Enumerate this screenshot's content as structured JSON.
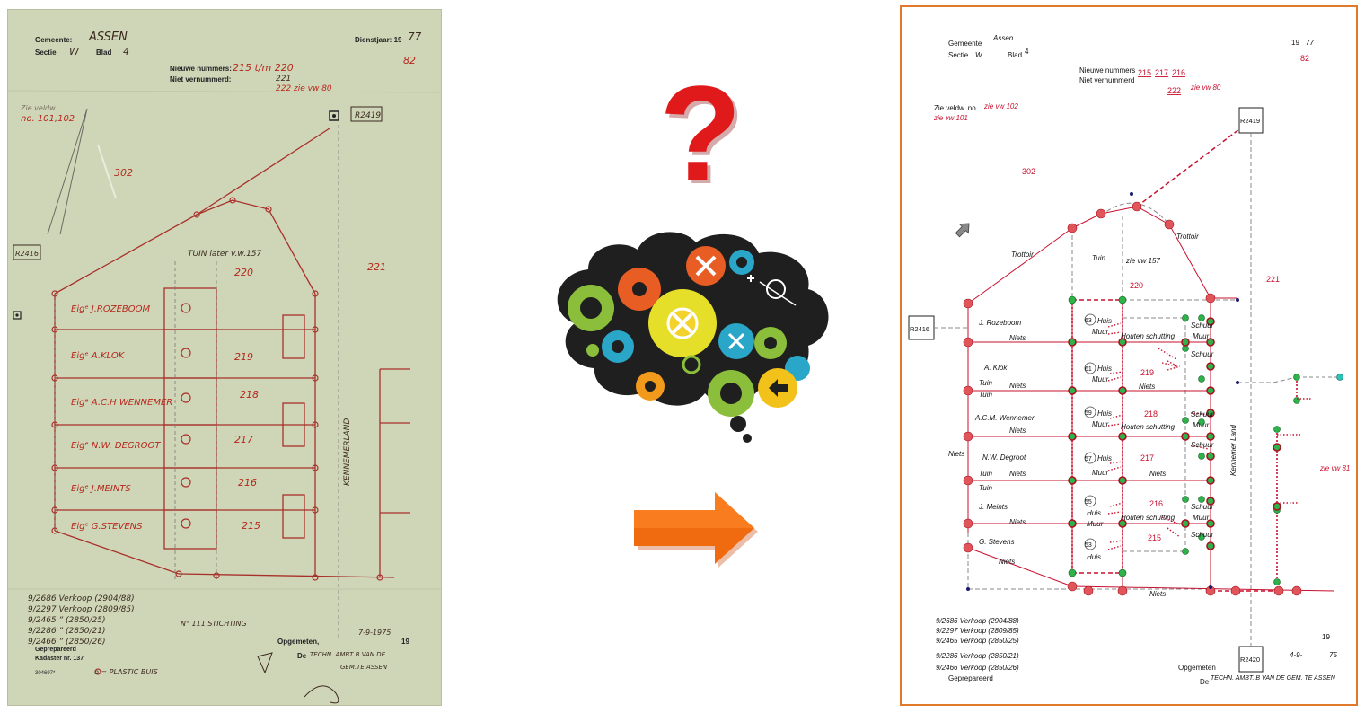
{
  "left_scan": {
    "gemeente_label": "Gemeente:",
    "gemeente_value": "ASSEN",
    "sectie_label": "Sectie",
    "sectie_value": "W",
    "blad_label": "Blad",
    "blad_value": "4",
    "dienstjaar_label": "Dienstjaar: 19",
    "dienstjaar_value": "77",
    "dienstjaar_extra": "82",
    "nieuwe_label": "Nieuwe nummers:",
    "nieuwe_value": "215 t/m 220",
    "niet_label": "Niet vernummerd:",
    "niet_value1": "221",
    "niet_value2": "222 zie vw 80",
    "zie_veldw": "Zie veldw.",
    "zie_no": "no. 101,102",
    "r2419": "R2419",
    "r2416": "R2416",
    "p302": "302",
    "p220": "220",
    "p221": "221",
    "p219": "219",
    "p218": "218",
    "p217": "217",
    "p216": "216",
    "p215": "215",
    "tuin_later": "TUIN later v.w.157",
    "owners": [
      "Eigᵉ J.ROZEBOOM",
      "Eigᵉ A.KLOK",
      "Eigᵉ A.C.H WENNEMER",
      "Eigᵉ N.W. DEGROOT",
      "Eigᵉ J.MEINTS",
      "Eigᵉ G.STEVENS"
    ],
    "kennemerland": "KENNEMERLAND",
    "verkoop": [
      "9/2686 Verkoop (2904/88)",
      "9/2297 Verkoop (2809/85)",
      "9/2465      ”      (2850/25)",
      "9/2286      ”      (2850/21)",
      "9/2466      ”      (2850/26)"
    ],
    "stichting": "N° 111 STICHTING",
    "plastic": "o = PLASTIC BUIS",
    "gepr": "Geprepareerd",
    "kadaster": "Kadaster nr. 137",
    "opgemeten": "Opgemeten,",
    "opgemeten_val": "7-9-1975",
    "de_label": "De",
    "de_val": "TECHN. AMBT B VAN DE",
    "de_val2": "GEM.TE ASSEN",
    "bottom_code": "304697*",
    "dienst_19": "19"
  },
  "middle": {
    "question_mark": "?",
    "arrow_name": "arrow-right"
  },
  "right_map": {
    "gemeente_label": "Gemeente",
    "gemeente_value": "Assen",
    "sectie_label": "Sectie",
    "sectie_value": "W",
    "blad_label": "Blad",
    "blad_value": "4",
    "year_19": "19",
    "year_77": "77",
    "year_82": "82",
    "nieuwe_label": "Nieuwe nummers",
    "niet_label": "Niet vernummerd",
    "nieuwe_215": "215",
    "nieuwe_217": "217",
    "nieuwe_216": "216",
    "niet_222": "222",
    "zie_vw80": "zie vw 80",
    "zie_veldw": "Zie veldw. no.",
    "zie_vw102": "zie vw 102",
    "zie_vw101": "zie vw 101",
    "r2419": "R2419",
    "r2416": "R2416",
    "r2420": "R2420",
    "p302": "302",
    "trottoir1": "Trottoir",
    "trottoir2": "Trottoir",
    "tuin": "Tuin",
    "zie_vw157": "zie vw 157",
    "p220": "220",
    "p221": "221",
    "p219": "219",
    "p218": "218",
    "p217": "217",
    "p216": "216",
    "p215": "215",
    "owners": [
      "J. Rozeboom",
      "A. Klok",
      "A.C.M. Wennemer",
      "N.W. Degroot",
      "J. Meints",
      "G. Stevens"
    ],
    "house_numbers": [
      "63",
      "61",
      "59",
      "57",
      "55",
      "53"
    ],
    "niets": "Niets",
    "huis": "Huis",
    "muur": "Muur",
    "schuur": "Schuur",
    "houten_schutting": "Houten schutting",
    "kennemer_land": "Kennemer Land",
    "zie_vw81": "zie vw 81",
    "verkoop": [
      "9/2686 Verkoop (2904/88)",
      "9/2297 Verkoop (2809/85)",
      "9/2465 Verkoop (2850/25)",
      "9/2286 Verkoop (2850/21)",
      "9/2466 Verkoop (2850/26)"
    ],
    "gepr": "Geprepareerd",
    "opgemeten": "Opgemeten",
    "de_label": "De",
    "techn": "TECHN. AMBT. B VAN DE GEM. TE ASSEN",
    "year_bottom": "19",
    "date_bottom": "4-9-",
    "date_bottom2": "75",
    "colors": {
      "border": "#e07a2a",
      "line": "#c8102e",
      "node_red": "#e0555a",
      "node_green": "#2db34a"
    }
  }
}
